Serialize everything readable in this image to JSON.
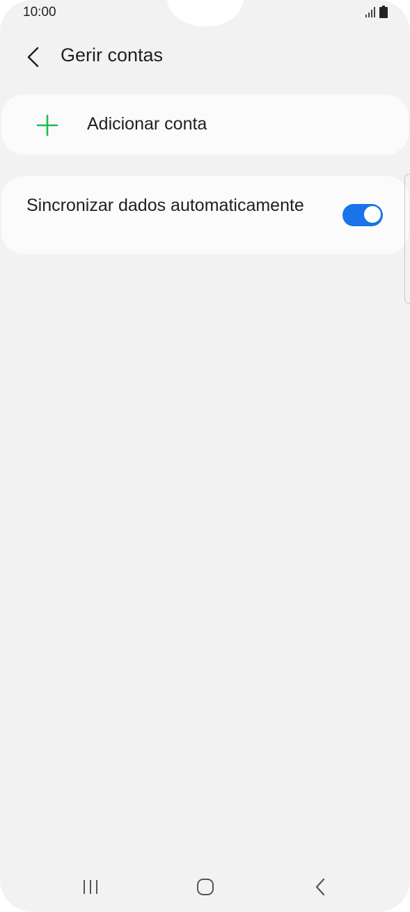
{
  "status_bar": {
    "time": "10:00",
    "icons": [
      "signal-icon",
      "battery-icon"
    ]
  },
  "header": {
    "back_icon": "chevron-left-icon",
    "title": "Gerir contas"
  },
  "add_account": {
    "icon": "plus-icon",
    "label": "Adicionar conta",
    "icon_color": "#1db954"
  },
  "sync": {
    "label": "Sincronizar dados automaticamente",
    "toggle_on": true,
    "accent_color": "#1a73e8"
  },
  "nav_bar": {
    "icons": [
      "recents-icon",
      "home-icon",
      "back-icon"
    ]
  }
}
